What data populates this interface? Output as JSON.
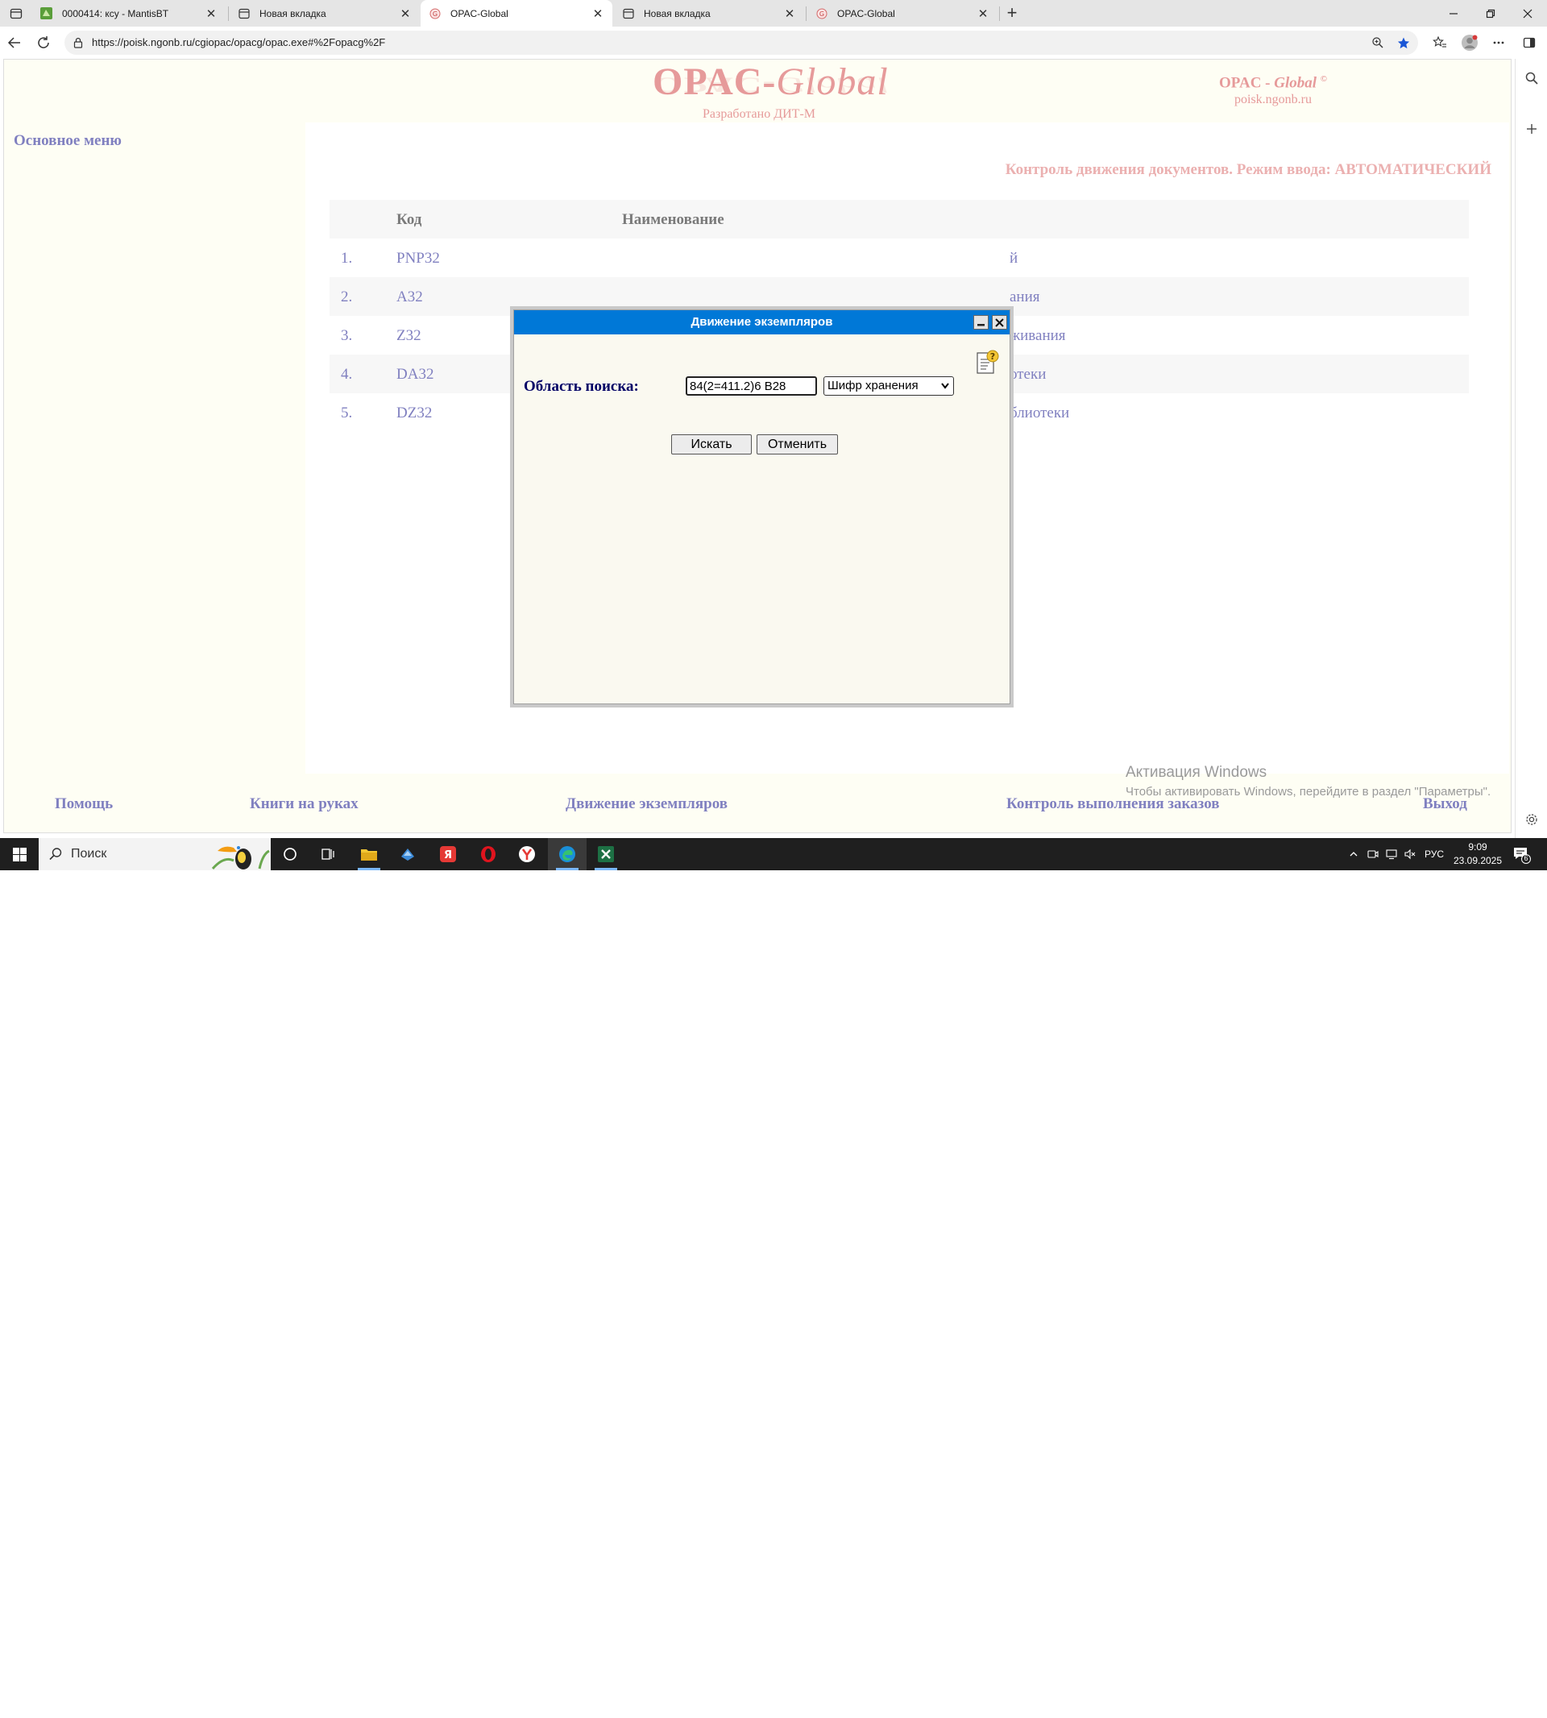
{
  "browser": {
    "tabs": [
      {
        "label": "0000414: ксу - MantisBT",
        "active": false
      },
      {
        "label": "Новая вкладка",
        "active": false
      },
      {
        "label": "OPAC-Global",
        "active": true
      },
      {
        "label": "Новая вкладка",
        "active": false
      },
      {
        "label": "OPAC-Global",
        "active": false
      }
    ],
    "url": "https://poisk.ngonb.ru/cgiopac/opacg/opac.exe#%2Fopacg%2F",
    "accent": "#0078d7"
  },
  "page": {
    "logo": {
      "part1": "OPAC-",
      "part2": "Global",
      "subtitle": "Разработано ДИТ-М"
    },
    "brand": {
      "part1": "OPAC - ",
      "part2": "Global",
      "copyright": "©",
      "site": "poisk.ngonb.ru"
    },
    "left_menu_title": "Основное меню",
    "content_title": "Контроль движения документов. Режим ввода: АВТОМАТИЧЕСКИЙ",
    "table": {
      "headers": {
        "code": "Код",
        "name": "Наименование"
      },
      "rows": [
        {
          "num": "1.",
          "code": "PNP32",
          "name_visible": "й"
        },
        {
          "num": "2.",
          "code": "A32",
          "name_visible": "ания"
        },
        {
          "num": "3.",
          "code": "Z32",
          "name_visible": "живания"
        },
        {
          "num": "4.",
          "code": "DA32",
          "name_visible": "отеки"
        },
        {
          "num": "5.",
          "code": "DZ32",
          "name_visible": "блиотеки"
        }
      ]
    },
    "footer_links": [
      "Помощь",
      "Книги на руках",
      "Движение экземпляров",
      "Контроль выполнения заказов",
      "Выход"
    ],
    "activation": {
      "title": "Активация Windows",
      "text": "Чтобы активировать Windows, перейдите в раздел \"Параметры\"."
    }
  },
  "dialog": {
    "title": "Движение экземпляров",
    "field_label": "Область поиска:",
    "search_value": "84(2=411.2)6 В28",
    "select_value": "Шифр хранения",
    "search_button": "Искать",
    "cancel_button": "Отменить"
  },
  "taskbar": {
    "search_placeholder": "Поиск",
    "language": "РУС",
    "time": "9:09",
    "date": "23.09.2025",
    "notification_count": "6"
  }
}
